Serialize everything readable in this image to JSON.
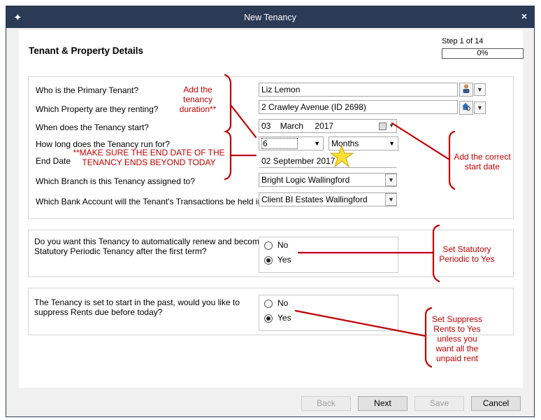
{
  "window": {
    "title": "New Tenancy",
    "close_glyph": "×"
  },
  "header": {
    "heading": "Tenant & Property Details",
    "step": "Step 1 of 14",
    "progress": "0%"
  },
  "details": {
    "primary_tenant": {
      "label": "Who is the Primary Tenant?",
      "value": "Liz Lemon"
    },
    "property": {
      "label": "Which Property are they renting?",
      "value": "2 Crawley Avenue  (ID 2698)"
    },
    "start": {
      "label": "When does the Tenancy start?",
      "day": "03",
      "month": "March",
      "year": "2017"
    },
    "duration": {
      "label": "How long does the Tenancy run for?",
      "value": "6",
      "unit": "Months"
    },
    "end_date": {
      "label": "End Date",
      "value": "02 September 2017"
    },
    "branch": {
      "label": "Which Branch is this Tenancy assigned to?",
      "value": "Bright Logic Wallingford"
    },
    "bank": {
      "label": "Which Bank Account will the Tenant's Transactions be held in?",
      "value": "Client BI Estates Wallingford"
    }
  },
  "renew": {
    "question_line1": "Do you want this Tenancy to automatically renew and become a",
    "question_line2": "Statutory Periodic Tenancy after the first term?",
    "options": [
      "No",
      "Yes"
    ],
    "selected": "Yes"
  },
  "suppress": {
    "question_line1": "The Tenancy is set to start in the past, would you like to",
    "question_line2": "suppress Rents due before today?",
    "options": [
      "No",
      "Yes"
    ],
    "selected": "Yes"
  },
  "buttons": {
    "back": "Back",
    "next": "Next",
    "save": "Save",
    "cancel": "Cancel"
  },
  "annotations": {
    "duration": [
      "Add the",
      "tenancy",
      "duration**"
    ],
    "end_date": [
      "**MAKE SURE THE END DATE OF THE",
      "TENANCY ENDS BEYOND TODAY"
    ],
    "start_date": [
      "Add the correct",
      "start date"
    ],
    "statutory": [
      "Set Statutory",
      "Periodic to Yes"
    ],
    "suppress": [
      "Set Suppress",
      "Rents to Yes",
      "unless you",
      "want all the",
      "unpaid rent"
    ]
  },
  "colors": {
    "titlebar": "#2b3a55",
    "annotation": "#c00000",
    "dialog_bg": "#f0f0f0"
  },
  "icons": [
    "app-logo-icon",
    "close-icon",
    "person-icon",
    "house-search-icon",
    "calendar-icon",
    "chevron-down-icon",
    "star-icon"
  ]
}
